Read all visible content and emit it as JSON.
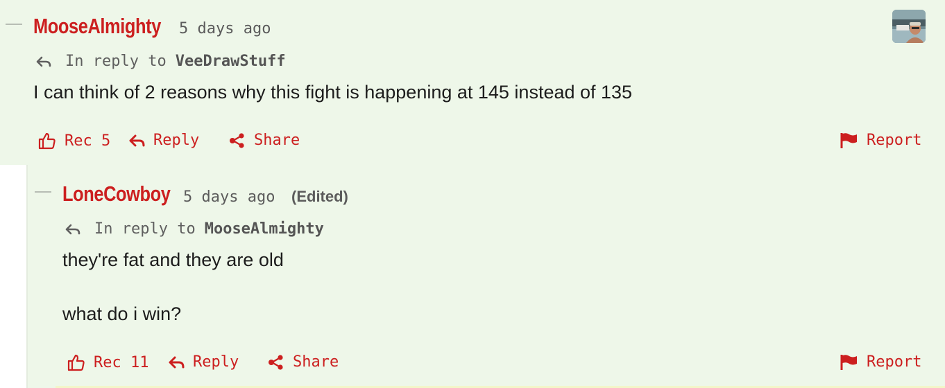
{
  "comments": [
    {
      "username": "MooseAlmighty",
      "timestamp": "5 days ago",
      "reply_prefix": "In reply to",
      "reply_to": "VeeDrawStuff",
      "body": [
        "I can think of 2 reasons why this fight is happening at 145 instead of 135"
      ],
      "actions": {
        "rec_label": "Rec",
        "rec_count": "5",
        "reply_label": "Reply",
        "share_label": "Share",
        "report_label": "Report"
      }
    },
    {
      "username": "LoneCowboy",
      "timestamp": "5 days ago",
      "edited": "(Edited)",
      "reply_prefix": "In reply to",
      "reply_to": "MooseAlmighty",
      "body": [
        "they're fat and they are old",
        "what do i win?"
      ],
      "actions": {
        "rec_label": "Rec",
        "rec_count": "11",
        "reply_label": "Reply",
        "share_label": "Share",
        "report_label": "Report"
      }
    }
  ],
  "colors": {
    "accent": "#cc1f1f",
    "comment_bg": "#eef7e9",
    "meta_text": "#5b5b5b",
    "body_text": "#1c1c1c"
  },
  "icons": [
    "thumbs-up-icon",
    "reply-arrow-icon",
    "share-icon",
    "flag-icon",
    "avatar"
  ]
}
